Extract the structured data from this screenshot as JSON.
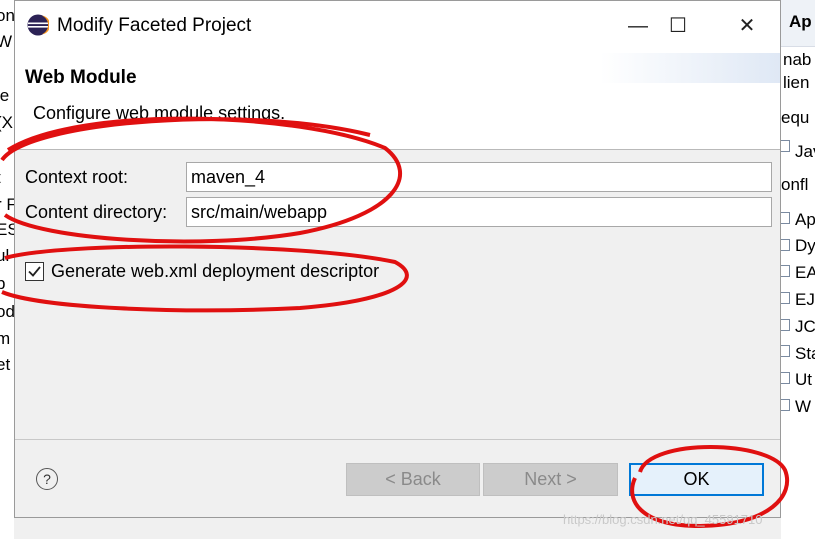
{
  "background": {
    "left_fragments": [
      "on",
      "W",
      "le",
      "(X",
      "t",
      "r F",
      "ES",
      "ul",
      "b",
      "od",
      "m",
      "et"
    ],
    "right_header": "Ap",
    "right_fragments": [
      "nab",
      "lien",
      "equ",
      "Jav",
      "onfl",
      "Ap",
      "Dy",
      "EA",
      "EJ",
      "JC",
      "Sta",
      "Ut",
      "W"
    ]
  },
  "window": {
    "title": "Modify Faceted Project",
    "minimize_glyph": "—",
    "maximize_glyph": "☐",
    "close_glyph": "✕"
  },
  "header": {
    "title": "Web Module",
    "description": "Configure web module settings."
  },
  "form": {
    "context_root_label": "Context root:",
    "context_root_value": "maven_4",
    "content_dir_label": "Content directory:",
    "content_dir_value": "src/main/webapp",
    "generate_label": "Generate web.xml deployment descriptor",
    "generate_checked": true
  },
  "buttons": {
    "help_glyph": "?",
    "back": "< Back",
    "next": "Next >",
    "ok": "OK"
  },
  "watermark": "https://blog.csdn.net/qq_45591710",
  "colors": {
    "accent": "#0078d7",
    "annotation": "#e01010"
  }
}
